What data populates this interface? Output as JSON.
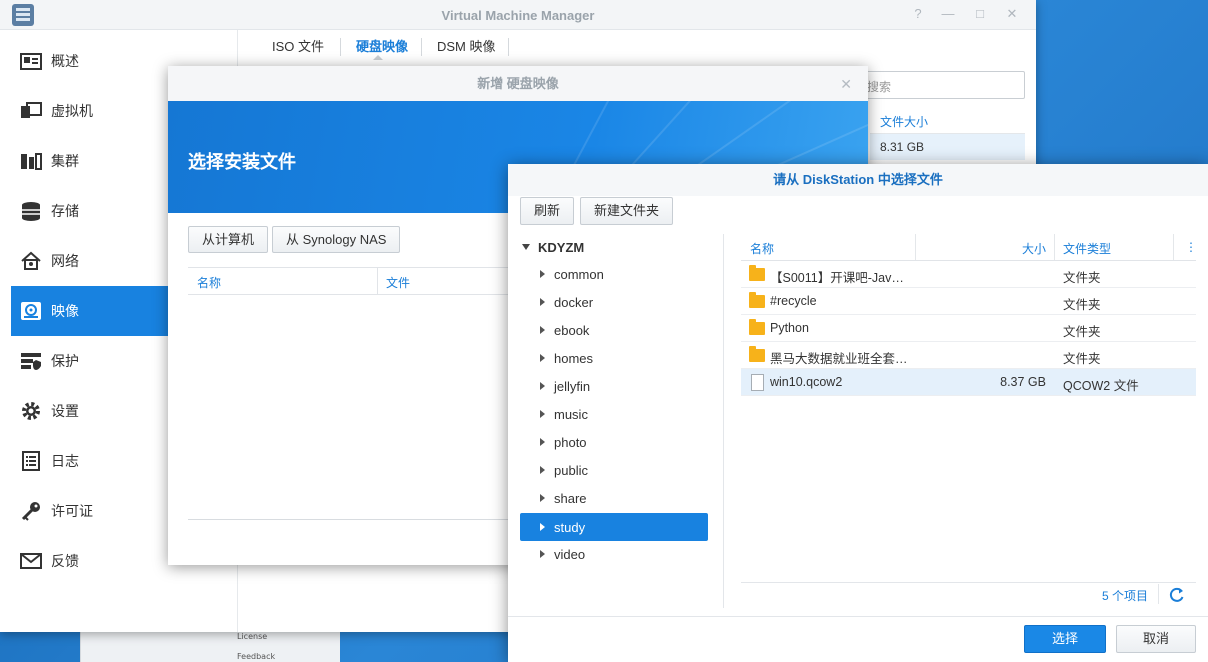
{
  "vmm": {
    "title": "Virtual Machine Manager",
    "sidebar": [
      {
        "label": "概述",
        "icon": "overview-icon"
      },
      {
        "label": "虚拟机",
        "icon": "virtual-machine-icon"
      },
      {
        "label": "集群",
        "icon": "cluster-icon"
      },
      {
        "label": "存储",
        "icon": "storage-icon"
      },
      {
        "label": "网络",
        "icon": "network-icon"
      },
      {
        "label": "映像",
        "icon": "image-icon",
        "active": true
      },
      {
        "label": "保护",
        "icon": "protection-icon"
      },
      {
        "label": "设置",
        "icon": "gear-icon"
      },
      {
        "label": "日志",
        "icon": "log-icon"
      },
      {
        "label": "许可证",
        "icon": "license-key-icon"
      },
      {
        "label": "反馈",
        "icon": "feedback-mail-icon"
      }
    ],
    "tabs": [
      {
        "label": "ISO 文件"
      },
      {
        "label": "硬盘映像",
        "active": true
      },
      {
        "label": "DSM 映像"
      }
    ],
    "search_placeholder": "搜索",
    "table": {
      "column_size": "文件大小",
      "row_size": "8.31 GB"
    }
  },
  "desktop": {
    "mini_license": "License",
    "mini_feedback": "Feedback"
  },
  "wizard": {
    "title": "新增 硬盘映像",
    "heading": "选择安装文件",
    "from_computer": "从计算机",
    "from_nas": "从 Synology NAS",
    "col_name": "名称",
    "col_file": "文件"
  },
  "picker": {
    "title": "请从 DiskStation 中选择文件",
    "refresh": "刷新",
    "new_folder": "新建文件夹",
    "tree_root": "KDYZM",
    "tree": [
      "common",
      "docker",
      "ebook",
      "homes",
      "jellyfin",
      "music",
      "photo",
      "public",
      "share",
      "study",
      "video"
    ],
    "tree_selected": "study",
    "columns": {
      "name": "名称",
      "size": "大小",
      "type": "文件类型"
    },
    "files": [
      {
        "name": "【S0011】开课吧-Jav…",
        "size": "",
        "type": "文件夹",
        "kind": "folder"
      },
      {
        "name": "#recycle",
        "size": "",
        "type": "文件夹",
        "kind": "folder"
      },
      {
        "name": "Python",
        "size": "",
        "type": "文件夹",
        "kind": "folder"
      },
      {
        "name": "黑马大数据就业班全套…",
        "size": "",
        "type": "文件夹",
        "kind": "folder"
      },
      {
        "name": "win10.qcow2",
        "size": "8.37 GB",
        "type": "QCOW2 文件",
        "kind": "file",
        "selected": true
      }
    ],
    "count": "5 个项目",
    "ok": "选择",
    "cancel": "取消"
  },
  "colors": {
    "accent": "#1882e0",
    "folder": "#f7b21a",
    "link": "#1a7ed8"
  }
}
